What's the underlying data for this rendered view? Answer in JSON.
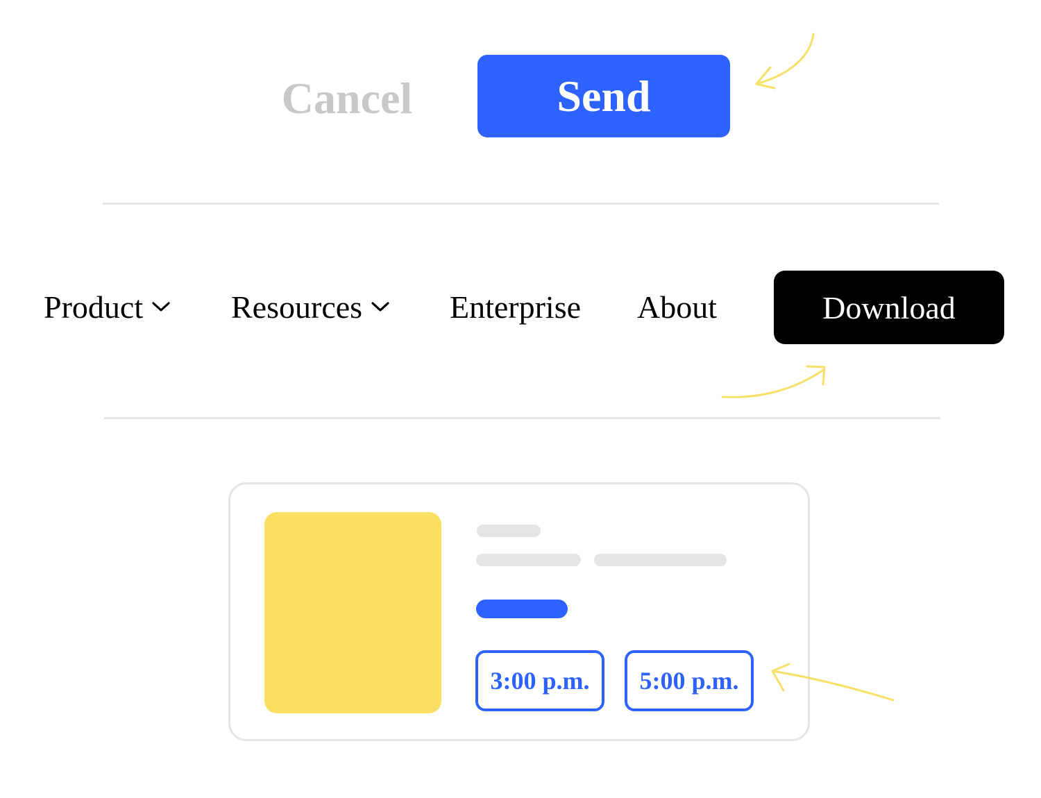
{
  "dialog_actions": {
    "cancel_label": "Cancel",
    "send_label": "Send"
  },
  "nav": {
    "items": [
      {
        "label": "Product",
        "has_dropdown": true
      },
      {
        "label": "Resources",
        "has_dropdown": true
      },
      {
        "label": "Enterprise",
        "has_dropdown": false
      },
      {
        "label": "About",
        "has_dropdown": false
      }
    ],
    "cta_label": "Download"
  },
  "booking_card": {
    "time_slots": [
      "3:00 p.m.",
      "5:00 p.m."
    ]
  },
  "colors": {
    "primary_blue": "#2d62ff",
    "muted_gray": "#c8c8c8",
    "skeleton_gray": "#e5e5e5",
    "accent_yellow": "#f9e060",
    "annotation_yellow": "#f7df68",
    "cta_black": "#000000"
  }
}
